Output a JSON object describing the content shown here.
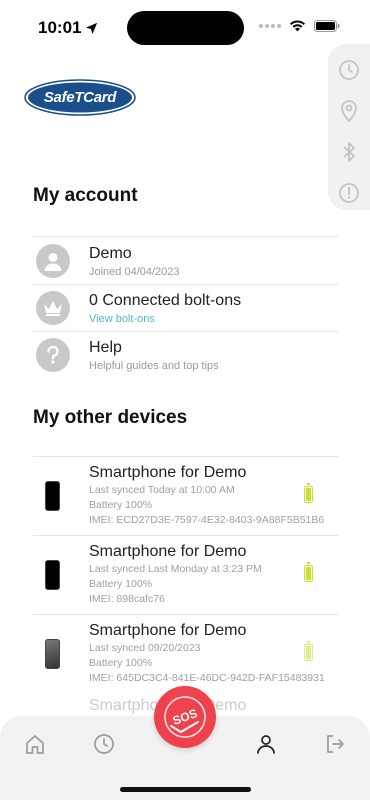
{
  "status_bar": {
    "time": "10:01"
  },
  "logo": {
    "text": "SafeTCard"
  },
  "side_panel": {
    "icons": [
      "clock-icon",
      "location-pin-icon",
      "bluetooth-icon",
      "alert-icon"
    ]
  },
  "account": {
    "title": "My account",
    "rows": [
      {
        "title": "Demo",
        "subtitle": "Joined 04/04/2023",
        "icon": "user-icon"
      },
      {
        "title": "0 Connected bolt-ons",
        "subtitle": "View bolt-ons",
        "icon": "crown-icon"
      },
      {
        "title": "Help",
        "subtitle": "Helpful guides and top tips",
        "icon": "question-icon"
      }
    ]
  },
  "devices": {
    "title": "My other devices",
    "items": [
      {
        "name": "Smartphone for Demo",
        "synced": "Last synced Today at 10:00 AM",
        "battery": "Battery 100%",
        "imei": "IMEI: ECD27D3E-7597-4E32-8403-9A88F5B51B6",
        "battery_level": 1.0
      },
      {
        "name": "Smartphone for Demo",
        "synced": "Last synced Last Monday at 3:23 PM",
        "battery": "Battery 100%",
        "imei": "IMEI: 898cafc76",
        "battery_level": 1.0
      },
      {
        "name": "Smartphone for Demo",
        "synced": "Last synced 09/20/2023",
        "battery": "Battery 100%",
        "imei": "IMEI: 645DC3C4-841E-46DC-942D-FAF15483931",
        "battery_level": 1.0
      }
    ],
    "partial_name": "Smartphone for Demo"
  },
  "tab_bar": {
    "items": [
      "home-icon",
      "clock-icon",
      "profile-icon",
      "logout-icon"
    ],
    "sos_label": "SOS"
  },
  "colors": {
    "accent_link": "#4fb8c8",
    "sos": "#f0424d",
    "battery": "#cfdf2e",
    "logo_blue": "#1b4f8c"
  }
}
